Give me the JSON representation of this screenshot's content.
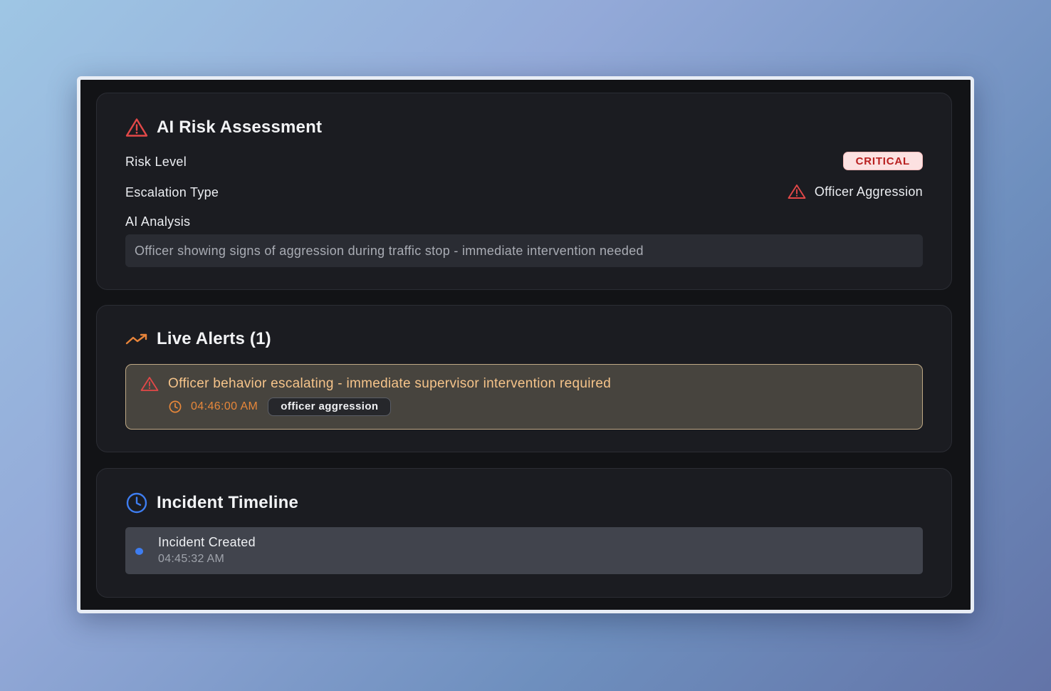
{
  "risk_assessment": {
    "title": "AI Risk Assessment",
    "title_icon": "alert-triangle-icon",
    "risk_level_label": "Risk Level",
    "risk_level_value": "CRITICAL",
    "escalation_type_label": "Escalation Type",
    "escalation_type_value": "Officer Aggression",
    "escalation_icon": "alert-triangle-icon",
    "analysis_label": "AI Analysis",
    "analysis_text": "Officer showing signs of aggression during traffic stop - immediate intervention needed"
  },
  "live_alerts": {
    "title": "Live Alerts (1)",
    "title_icon": "trending-up-icon",
    "items": [
      {
        "message": "Officer behavior escalating - immediate supervisor intervention required",
        "time": "04:46:00 AM",
        "tag": "officer aggression",
        "icon": "alert-triangle-icon",
        "time_icon": "clock-icon"
      }
    ]
  },
  "incident_timeline": {
    "title": "Incident Timeline",
    "title_icon": "clock-icon",
    "items": [
      {
        "title": "Incident Created",
        "time": "04:45:32 AM"
      }
    ]
  },
  "colors": {
    "critical_red": "#b81f1f",
    "alert_orange": "#e7873a",
    "alert_text": "#f6c48a",
    "timeline_blue": "#3e7df0",
    "card_background": "#1b1c21"
  }
}
